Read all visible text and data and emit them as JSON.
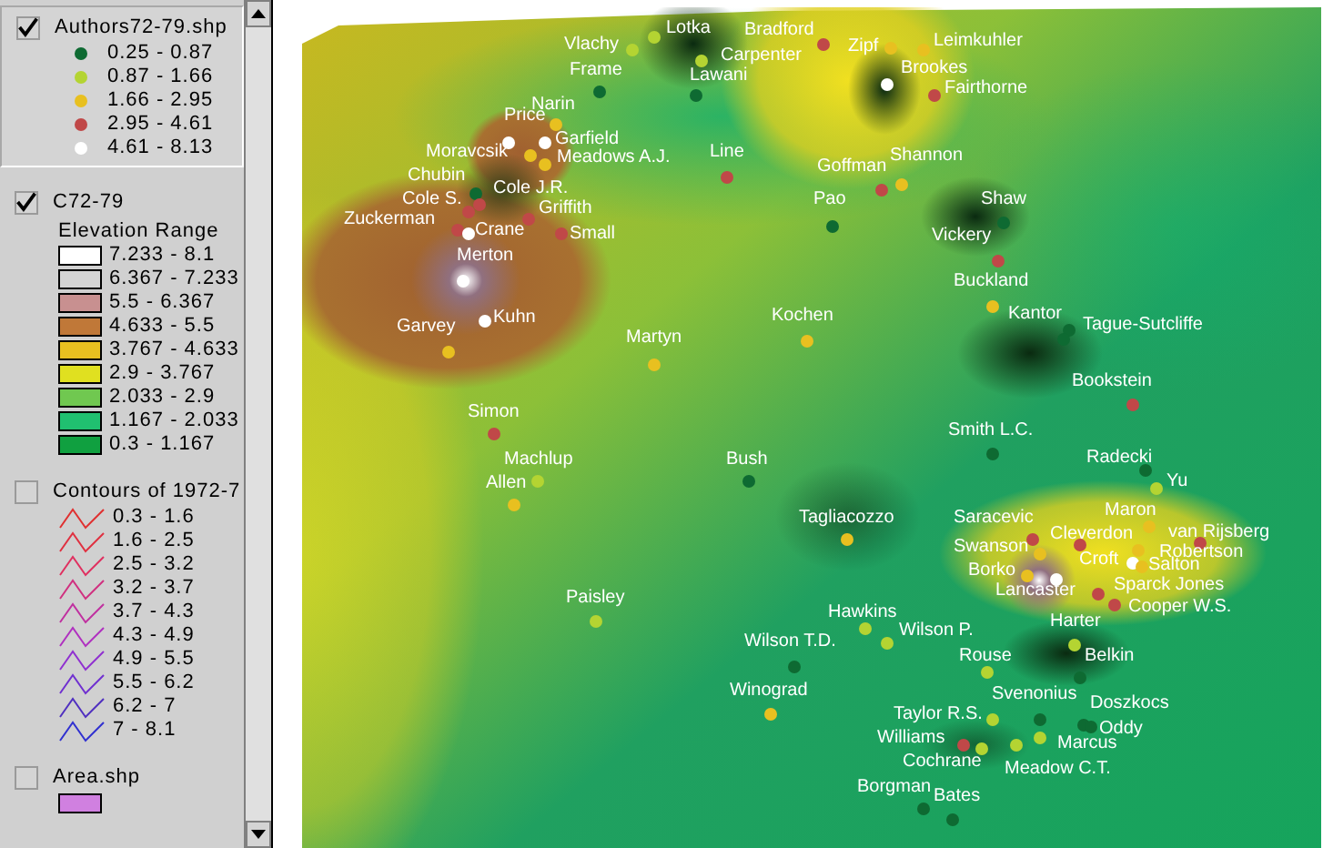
{
  "legend": {
    "layers": [
      {
        "kind": "points",
        "name": "Authors72-79.shp",
        "checked": true,
        "selected": true,
        "classes": [
          {
            "label": "0.25 - 0.87",
            "color": "#0e6a32"
          },
          {
            "label": "0.87 - 1.66",
            "color": "#b4d432"
          },
          {
            "label": "1.66 - 2.95",
            "color": "#e8c020"
          },
          {
            "label": "2.95 - 4.61",
            "color": "#c04848"
          },
          {
            "label": "4.61 - 8.13",
            "color": "#ffffff"
          }
        ]
      },
      {
        "kind": "raster",
        "name": "C72-79",
        "subtitle": "Elevation Range",
        "checked": true,
        "selected": false,
        "classes": [
          {
            "label": "7.233 - 8.1",
            "color": "#ffffff"
          },
          {
            "label": "6.367 - 7.233",
            "color": "#d4d4d4"
          },
          {
            "label": "5.5 - 6.367",
            "color": "#c89090"
          },
          {
            "label": "4.633 - 5.5",
            "color": "#c07838"
          },
          {
            "label": "3.767 - 4.633",
            "color": "#e8c020"
          },
          {
            "label": "2.9 - 3.767",
            "color": "#e0e020"
          },
          {
            "label": "2.033 - 2.9",
            "color": "#70c850"
          },
          {
            "label": "1.167 - 2.033",
            "color": "#20c070"
          },
          {
            "label": "0.3 - 1.167",
            "color": "#10a040"
          }
        ]
      },
      {
        "kind": "lines",
        "name": "Contours of 1972-7",
        "checked": false,
        "selected": false,
        "classes": [
          {
            "label": "0.3 - 1.6",
            "color": "#e03030"
          },
          {
            "label": "1.6 - 2.5",
            "color": "#e03040"
          },
          {
            "label": "2.5 - 3.2",
            "color": "#e03060"
          },
          {
            "label": "3.2 - 3.7",
            "color": "#d03080"
          },
          {
            "label": "3.7 - 4.3",
            "color": "#c030a0"
          },
          {
            "label": "4.3 - 4.9",
            "color": "#b030c0"
          },
          {
            "label": "4.9 - 5.5",
            "color": "#9030d0"
          },
          {
            "label": "5.5 - 6.2",
            "color": "#7030d0"
          },
          {
            "label": "6.2 - 7",
            "color": "#5030c0"
          },
          {
            "label": "7 - 8.1",
            "color": "#3030d0"
          }
        ]
      },
      {
        "kind": "fill",
        "name": "Area.shp",
        "checked": false,
        "selected": false,
        "classes": [
          {
            "color": "#d080e0"
          }
        ]
      }
    ]
  },
  "map": {
    "authors": [
      {
        "name": "Vlachy",
        "color": "#b4d432"
      },
      {
        "name": "Lotka",
        "color": "#b4d432"
      },
      {
        "name": "Carpenter",
        "color": "#b4d432"
      },
      {
        "name": "Frame",
        "color": "#0e6a32"
      },
      {
        "name": "Lawani",
        "color": "#0e6a32"
      },
      {
        "name": "Bradford",
        "color": "#c04848"
      },
      {
        "name": "Zipf",
        "color": "#e8c020"
      },
      {
        "name": "Leimkuhler",
        "color": "#e8c020"
      },
      {
        "name": "Brookes",
        "color": "#ffffff"
      },
      {
        "name": "Fairthorne",
        "color": "#c04848"
      },
      {
        "name": "Narin",
        "color": "#e8c020"
      },
      {
        "name": "Price",
        "color": "#ffffff"
      },
      {
        "name": "Garfield",
        "color": "#ffffff"
      },
      {
        "name": "Moravcsik",
        "color": "#e8c020"
      },
      {
        "name": "Meadows A.J.",
        "color": "#e8c020"
      },
      {
        "name": "Line",
        "color": "#c04848"
      },
      {
        "name": "Chubin",
        "color": "#0e6a32"
      },
      {
        "name": "Cole J.R.",
        "color": "#c04848"
      },
      {
        "name": "Cole S.",
        "color": "#c04848"
      },
      {
        "name": "Griffith",
        "color": "#c04848"
      },
      {
        "name": "Zuckerman",
        "color": "#c04848"
      },
      {
        "name": "Crane",
        "color": "#ffffff"
      },
      {
        "name": "Small",
        "color": "#c04848"
      },
      {
        "name": "Merton",
        "color": "#ffffff"
      },
      {
        "name": "Kuhn",
        "color": "#ffffff"
      },
      {
        "name": "Garvey",
        "color": "#e8c020"
      },
      {
        "name": "Martyn",
        "color": "#e8c020"
      },
      {
        "name": "Goffman",
        "color": "#c04848"
      },
      {
        "name": "Shannon",
        "color": "#e8c020"
      },
      {
        "name": "Pao",
        "color": "#0e6a32"
      },
      {
        "name": "Shaw",
        "color": "#0e6a32"
      },
      {
        "name": "Vickery",
        "color": "#c04848"
      },
      {
        "name": "Buckland",
        "color": "#e8c020"
      },
      {
        "name": "Kochen",
        "color": "#e8c020"
      },
      {
        "name": "Kantor",
        "color": "#0e6a32"
      },
      {
        "name": "Tague-Sutcliffe",
        "color": "#0e6a32"
      },
      {
        "name": "Bookstein",
        "color": "#c04848"
      },
      {
        "name": "Simon",
        "color": "#c04848"
      },
      {
        "name": "Machlup",
        "color": "#b4d432"
      },
      {
        "name": "Allen",
        "color": "#e8c020"
      },
      {
        "name": "Bush",
        "color": "#0e6a32"
      },
      {
        "name": "Paisley",
        "color": "#b4d432"
      },
      {
        "name": "Wilson T.D.",
        "color": "#0e6a32"
      },
      {
        "name": "Winograd",
        "color": "#e8c020"
      },
      {
        "name": "Smith L.C.",
        "color": "#0e6a32"
      },
      {
        "name": "Radecki",
        "color": "#0e6a32"
      },
      {
        "name": "Yu",
        "color": "#b4d432"
      },
      {
        "name": "Tagliacozzo",
        "color": "#e8c020"
      },
      {
        "name": "Saracevic",
        "color": "#c04848"
      },
      {
        "name": "Maron",
        "color": "#e8c020"
      },
      {
        "name": "Cleverdon",
        "color": "#c04848"
      },
      {
        "name": "van Rijsberg",
        "color": "#c04848"
      },
      {
        "name": "Swanson",
        "color": "#e8c020"
      },
      {
        "name": "Robertson",
        "color": "#e8c020"
      },
      {
        "name": "Croft",
        "color": "#ffffff"
      },
      {
        "name": "Borko",
        "color": "#e8c020"
      },
      {
        "name": "Salton",
        "color": "#e8c020"
      },
      {
        "name": "Lancaster",
        "color": "#ffffff"
      },
      {
        "name": "Sparck Jones",
        "color": "#c04848"
      },
      {
        "name": "Cooper W.S.",
        "color": "#c04848"
      },
      {
        "name": "Hawkins",
        "color": "#b4d432"
      },
      {
        "name": "Wilson P.",
        "color": "#b4d432"
      },
      {
        "name": "Harter",
        "color": "#b4d432"
      },
      {
        "name": "Belkin",
        "color": "#0e6a32"
      },
      {
        "name": "Rouse",
        "color": "#b4d432"
      },
      {
        "name": "Svenonius",
        "color": "#0e6a32"
      },
      {
        "name": "Doszkocs",
        "color": "#0e6a32"
      },
      {
        "name": "Taylor R.S.",
        "color": "#b4d432"
      },
      {
        "name": "Oddy",
        "color": "#0e6a32"
      },
      {
        "name": "Williams",
        "color": "#c04848"
      },
      {
        "name": "Marcus",
        "color": "#b4d432"
      },
      {
        "name": "Cochrane",
        "color": "#b4d432"
      },
      {
        "name": "Meadow C.T.",
        "color": "#b4d432"
      },
      {
        "name": "Borgman",
        "color": "#0e6a32"
      },
      {
        "name": "Bates",
        "color": "#0e6a32"
      }
    ]
  }
}
